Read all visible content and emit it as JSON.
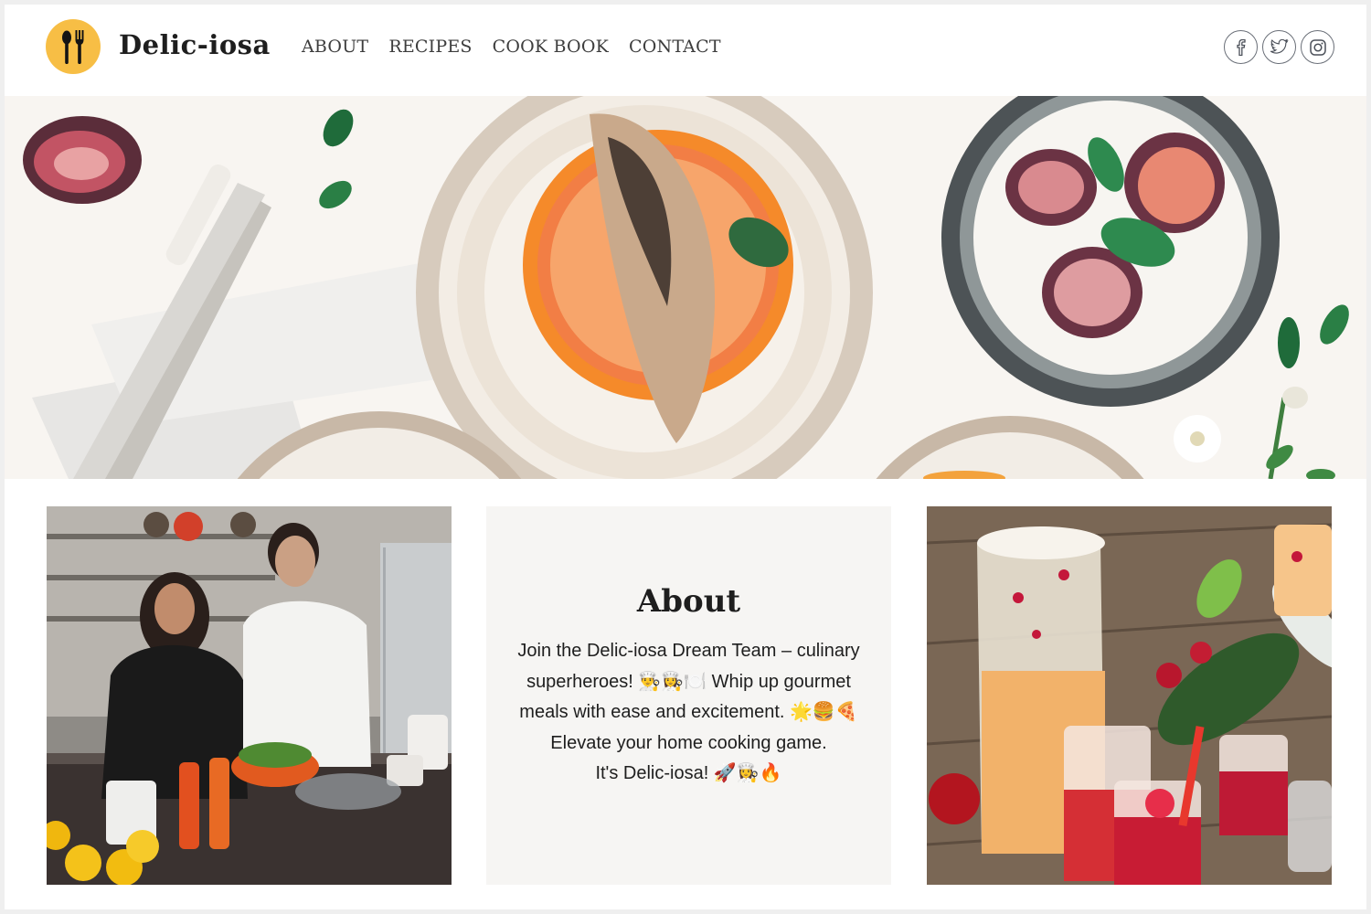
{
  "brand": {
    "name": "Delic-iosa"
  },
  "nav": {
    "items": [
      {
        "label": "ABOUT"
      },
      {
        "label": "RECIPES"
      },
      {
        "label": "COOK BOOK"
      },
      {
        "label": "CONTACT"
      }
    ]
  },
  "social": {
    "icons": [
      "facebook-icon",
      "twitter-icon",
      "instagram-icon"
    ]
  },
  "about": {
    "title": "About",
    "text": "Join the Delic-iosa Dream Team – culinary\nsuperheroes! 👨‍🍳👩‍🍳🍽️ Whip up gourmet\nmeals with ease and excitement. 🌟🍔🍕\nElevate your home cooking game.\nIt's Delic-iosa! 🚀👩‍🍳🔥"
  },
  "colors": {
    "logo_badge": "#f7be45",
    "about_bg": "#f6f5f3",
    "text": "#1e1e1e",
    "nav_text": "#3d3d3d"
  }
}
